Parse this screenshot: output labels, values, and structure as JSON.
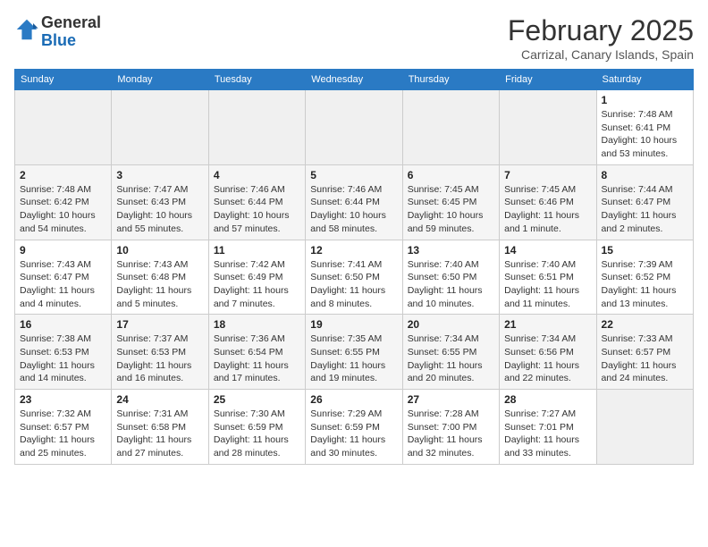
{
  "header": {
    "logo_general": "General",
    "logo_blue": "Blue",
    "month_title": "February 2025",
    "location": "Carrizal, Canary Islands, Spain"
  },
  "weekdays": [
    "Sunday",
    "Monday",
    "Tuesday",
    "Wednesday",
    "Thursday",
    "Friday",
    "Saturday"
  ],
  "weeks": [
    [
      {
        "day": "",
        "info": ""
      },
      {
        "day": "",
        "info": ""
      },
      {
        "day": "",
        "info": ""
      },
      {
        "day": "",
        "info": ""
      },
      {
        "day": "",
        "info": ""
      },
      {
        "day": "",
        "info": ""
      },
      {
        "day": "1",
        "info": "Sunrise: 7:48 AM\nSunset: 6:41 PM\nDaylight: 10 hours\nand 53 minutes."
      }
    ],
    [
      {
        "day": "2",
        "info": "Sunrise: 7:48 AM\nSunset: 6:42 PM\nDaylight: 10 hours\nand 54 minutes."
      },
      {
        "day": "3",
        "info": "Sunrise: 7:47 AM\nSunset: 6:43 PM\nDaylight: 10 hours\nand 55 minutes."
      },
      {
        "day": "4",
        "info": "Sunrise: 7:46 AM\nSunset: 6:44 PM\nDaylight: 10 hours\nand 57 minutes."
      },
      {
        "day": "5",
        "info": "Sunrise: 7:46 AM\nSunset: 6:44 PM\nDaylight: 10 hours\nand 58 minutes."
      },
      {
        "day": "6",
        "info": "Sunrise: 7:45 AM\nSunset: 6:45 PM\nDaylight: 10 hours\nand 59 minutes."
      },
      {
        "day": "7",
        "info": "Sunrise: 7:45 AM\nSunset: 6:46 PM\nDaylight: 11 hours\nand 1 minute."
      },
      {
        "day": "8",
        "info": "Sunrise: 7:44 AM\nSunset: 6:47 PM\nDaylight: 11 hours\nand 2 minutes."
      }
    ],
    [
      {
        "day": "9",
        "info": "Sunrise: 7:43 AM\nSunset: 6:47 PM\nDaylight: 11 hours\nand 4 minutes."
      },
      {
        "day": "10",
        "info": "Sunrise: 7:43 AM\nSunset: 6:48 PM\nDaylight: 11 hours\nand 5 minutes."
      },
      {
        "day": "11",
        "info": "Sunrise: 7:42 AM\nSunset: 6:49 PM\nDaylight: 11 hours\nand 7 minutes."
      },
      {
        "day": "12",
        "info": "Sunrise: 7:41 AM\nSunset: 6:50 PM\nDaylight: 11 hours\nand 8 minutes."
      },
      {
        "day": "13",
        "info": "Sunrise: 7:40 AM\nSunset: 6:50 PM\nDaylight: 11 hours\nand 10 minutes."
      },
      {
        "day": "14",
        "info": "Sunrise: 7:40 AM\nSunset: 6:51 PM\nDaylight: 11 hours\nand 11 minutes."
      },
      {
        "day": "15",
        "info": "Sunrise: 7:39 AM\nSunset: 6:52 PM\nDaylight: 11 hours\nand 13 minutes."
      }
    ],
    [
      {
        "day": "16",
        "info": "Sunrise: 7:38 AM\nSunset: 6:53 PM\nDaylight: 11 hours\nand 14 minutes."
      },
      {
        "day": "17",
        "info": "Sunrise: 7:37 AM\nSunset: 6:53 PM\nDaylight: 11 hours\nand 16 minutes."
      },
      {
        "day": "18",
        "info": "Sunrise: 7:36 AM\nSunset: 6:54 PM\nDaylight: 11 hours\nand 17 minutes."
      },
      {
        "day": "19",
        "info": "Sunrise: 7:35 AM\nSunset: 6:55 PM\nDaylight: 11 hours\nand 19 minutes."
      },
      {
        "day": "20",
        "info": "Sunrise: 7:34 AM\nSunset: 6:55 PM\nDaylight: 11 hours\nand 20 minutes."
      },
      {
        "day": "21",
        "info": "Sunrise: 7:34 AM\nSunset: 6:56 PM\nDaylight: 11 hours\nand 22 minutes."
      },
      {
        "day": "22",
        "info": "Sunrise: 7:33 AM\nSunset: 6:57 PM\nDaylight: 11 hours\nand 24 minutes."
      }
    ],
    [
      {
        "day": "23",
        "info": "Sunrise: 7:32 AM\nSunset: 6:57 PM\nDaylight: 11 hours\nand 25 minutes."
      },
      {
        "day": "24",
        "info": "Sunrise: 7:31 AM\nSunset: 6:58 PM\nDaylight: 11 hours\nand 27 minutes."
      },
      {
        "day": "25",
        "info": "Sunrise: 7:30 AM\nSunset: 6:59 PM\nDaylight: 11 hours\nand 28 minutes."
      },
      {
        "day": "26",
        "info": "Sunrise: 7:29 AM\nSunset: 6:59 PM\nDaylight: 11 hours\nand 30 minutes."
      },
      {
        "day": "27",
        "info": "Sunrise: 7:28 AM\nSunset: 7:00 PM\nDaylight: 11 hours\nand 32 minutes."
      },
      {
        "day": "28",
        "info": "Sunrise: 7:27 AM\nSunset: 7:01 PM\nDaylight: 11 hours\nand 33 minutes."
      },
      {
        "day": "",
        "info": ""
      }
    ]
  ]
}
